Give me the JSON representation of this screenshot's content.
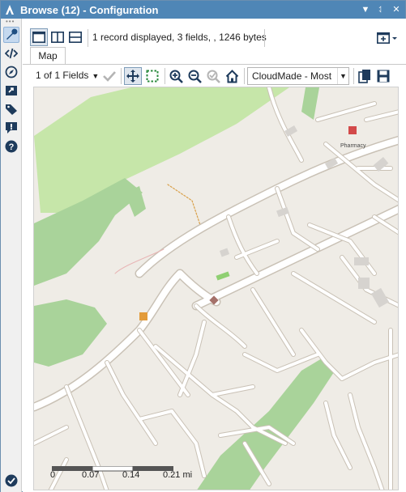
{
  "window": {
    "title": "Browse (12) - Configuration",
    "accent": "#4f86b6"
  },
  "toolbar": {
    "record_info": "1 record displayed, 3 fields, , 1246 bytes"
  },
  "tabs": [
    {
      "label": "Map",
      "active": true
    }
  ],
  "map_toolbar": {
    "field_selector": "1 of 1 Fields",
    "basemap": "CloudMade - Most"
  },
  "map": {
    "scale": {
      "ticks": [
        "0",
        "0.07",
        "0.14",
        "0.21 mi"
      ]
    },
    "place_labels": [
      "Pharmacy"
    ],
    "colors": {
      "background": "#efece6",
      "park": "#a9d39a",
      "light_green": "#c6e6a9",
      "road": "#ffffff",
      "road_casing": "#c9c1b5",
      "building": "#d6d3cf",
      "marker": "#a5716a"
    }
  },
  "sidebar": {
    "icons": [
      "wrench-icon",
      "code-icon",
      "compass-icon",
      "export-icon",
      "tag-icon",
      "alert-icon",
      "help-icon",
      "check-icon"
    ]
  }
}
